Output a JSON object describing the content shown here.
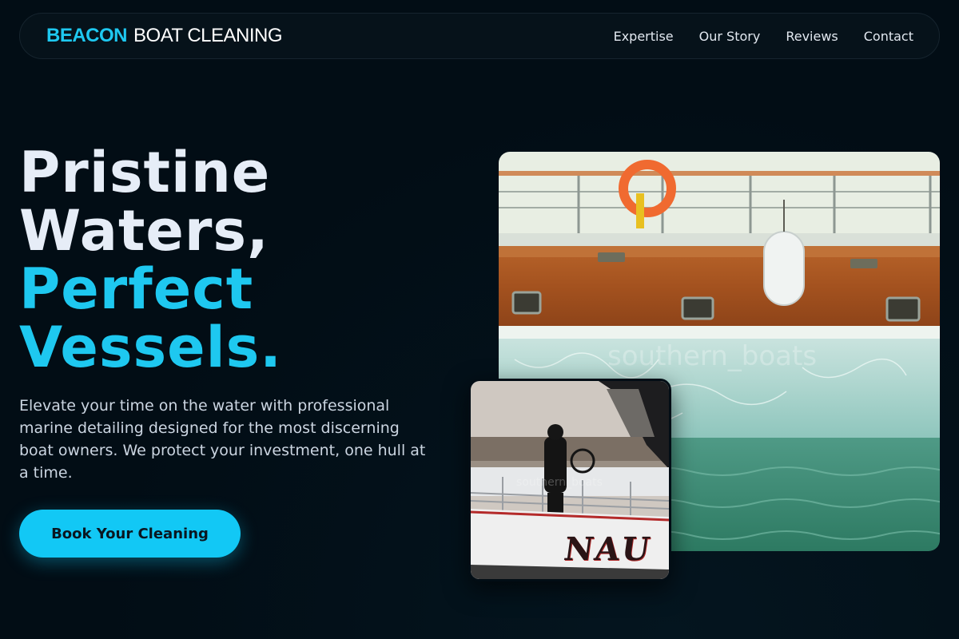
{
  "nav": {
    "brand": "BEACON",
    "brand_rest": "BOAT CLEANING",
    "links": [
      "Expertise",
      "Our Story",
      "Reviews",
      "Contact"
    ]
  },
  "hero": {
    "title_line1": "Pristine",
    "title_line2": "Waters,",
    "title_line3": "Perfect",
    "title_line4": "Vessels.",
    "description": "Elevate your time on the water with professional marine detailing designed for the most discerning boat owners. We protect your investment, one hull at a time.",
    "cta_label": "Book Your Cleaning"
  },
  "images": {
    "main_watermark": "southern_boats",
    "inset_watermark": "southern_boats",
    "inset_hull_text": "NAU"
  },
  "colors": {
    "background": "#020d15",
    "accent": "#1ec8f0",
    "button": "#12c8f5"
  }
}
